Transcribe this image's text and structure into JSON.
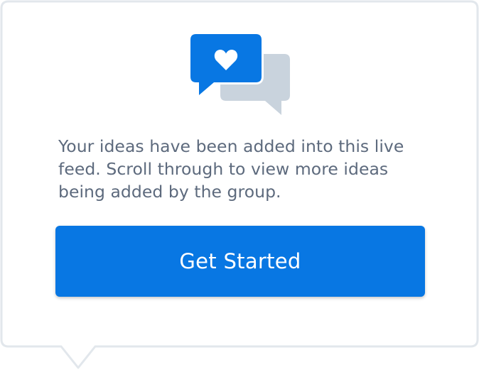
{
  "dialog": {
    "icon": "chat-bubbles-heart-icon",
    "message": "Your ideas have been added into this live feed. Scroll through to view more ideas being added by the group.",
    "button_label": "Get Started"
  },
  "colors": {
    "accent": "#0877e3",
    "text": "#5d6a7d",
    "secondary_bubble": "#c9d3dd",
    "frame_border": "#e2e7ec"
  }
}
